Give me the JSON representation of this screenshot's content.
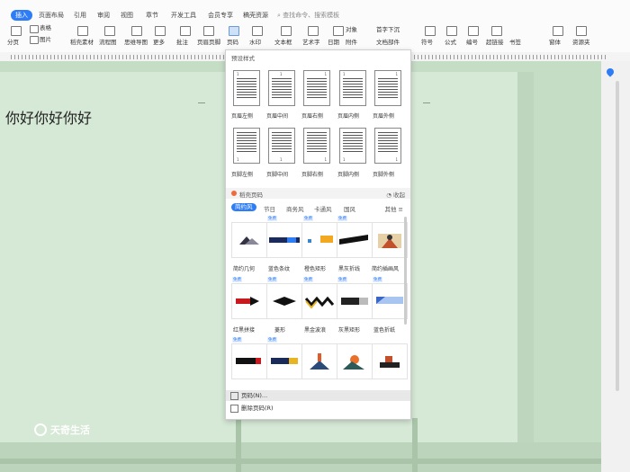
{
  "menubar": {
    "tabs": [
      {
        "label": "插入",
        "active": true
      },
      {
        "label": "页面布局"
      },
      {
        "label": "引用"
      },
      {
        "label": "审阅"
      },
      {
        "label": "视图"
      },
      {
        "label": "章节"
      },
      {
        "label": "开发工具"
      },
      {
        "label": "会员专享"
      },
      {
        "label": "稿壳资源"
      }
    ],
    "search_placeholder": "查找命令、搜索模板"
  },
  "ribbon": {
    "items": [
      {
        "label": "分页"
      },
      {
        "label": "表格"
      },
      {
        "label": "图片"
      },
      {
        "label": "形状"
      },
      {
        "label": "图表"
      },
      {
        "label": "稻壳素材"
      },
      {
        "label": "流程图"
      },
      {
        "label": "思维导图"
      },
      {
        "label": "更多"
      },
      {
        "label": "批注"
      },
      {
        "label": "页眉页脚"
      },
      {
        "label": "页码"
      },
      {
        "label": "水印"
      },
      {
        "label": "文本框"
      },
      {
        "label": "艺术字"
      },
      {
        "label": "日期"
      },
      {
        "label": "附件"
      },
      {
        "label": "对象"
      },
      {
        "label": "首字下沉"
      },
      {
        "label": "文档部件"
      },
      {
        "label": "符号"
      },
      {
        "label": "公式"
      },
      {
        "label": "编号"
      },
      {
        "label": "超链接"
      },
      {
        "label": "书签"
      },
      {
        "label": "窗体"
      },
      {
        "label": "资源夹"
      }
    ]
  },
  "document": {
    "text": "你好你好你好"
  },
  "page_number_panel": {
    "title": "预设样式",
    "presets": [
      {
        "label": "页眉左侧"
      },
      {
        "label": "页眉中间"
      },
      {
        "label": "页眉右侧"
      },
      {
        "label": "页眉内侧"
      },
      {
        "label": "页眉外侧"
      },
      {
        "label": "页脚左侧"
      },
      {
        "label": "页脚中间"
      },
      {
        "label": "页脚右侧"
      },
      {
        "label": "页脚内侧"
      },
      {
        "label": "页脚外侧"
      }
    ],
    "section_title": "稻壳页码",
    "collapse_label": "收起",
    "tabs": [
      {
        "label": "简约风",
        "active": true
      },
      {
        "label": "节日"
      },
      {
        "label": "商务风"
      },
      {
        "label": "卡通风"
      },
      {
        "label": "国风"
      }
    ],
    "more_label": "其他",
    "templates_row1": [
      {
        "tag": "免费",
        "label": "简约几何"
      },
      {
        "tag": "免费",
        "label": "蓝色条纹"
      },
      {
        "tag": "免费",
        "label": "橙色矩形"
      },
      {
        "tag": "免费",
        "label": "黑灰折线"
      },
      {
        "tag": "",
        "label": "简约插画风"
      }
    ],
    "templates_row2": [
      {
        "tag": "免费",
        "label": "红黑拼接"
      },
      {
        "tag": "免费",
        "label": "菱形"
      },
      {
        "tag": "免费",
        "label": "黑金波浪"
      },
      {
        "tag": "免费",
        "label": "灰黑矩形"
      },
      {
        "tag": "免费",
        "label": "蓝色折纸"
      }
    ],
    "templates_row3": [
      {
        "tag": "免费",
        "label": ""
      },
      {
        "tag": "免费",
        "label": ""
      },
      {
        "tag": "",
        "label": ""
      },
      {
        "tag": "",
        "label": ""
      },
      {
        "tag": "",
        "label": ""
      }
    ],
    "footer": {
      "page_number_label": "页码(N)...",
      "delete_label": "删除页码(R)"
    }
  },
  "watermark": {
    "text": "天奇生活"
  },
  "colors": {
    "accent": "#2f7df6",
    "page": "#d6e8d6",
    "background": "#c5dcc5"
  }
}
